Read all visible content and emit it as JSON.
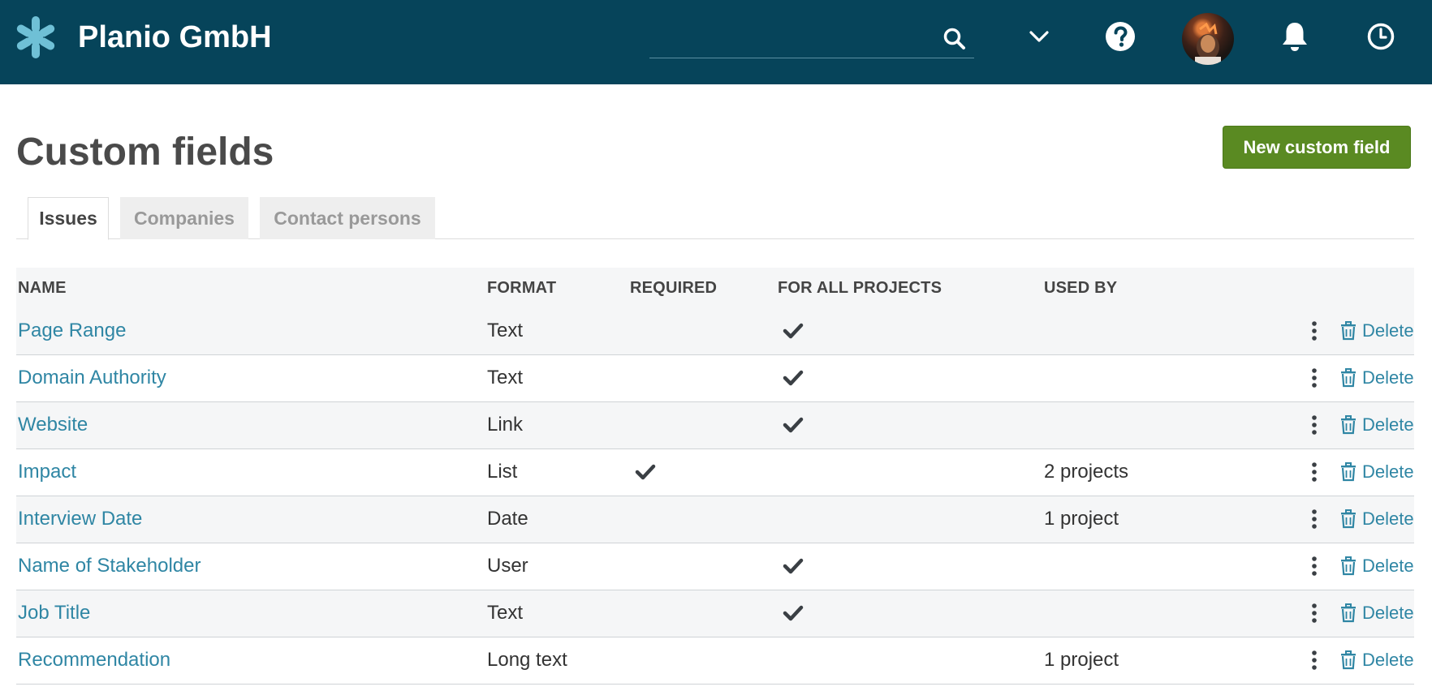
{
  "header": {
    "brand": "Planio GmbH",
    "search_placeholder": "",
    "colors": {
      "topbar": "#06445a",
      "accent": "#2f86a4",
      "primary_button": "#5a8a22"
    }
  },
  "page": {
    "title": "Custom fields",
    "new_button": "New custom field"
  },
  "tabs": [
    {
      "label": "Issues",
      "active": true
    },
    {
      "label": "Companies",
      "active": false
    },
    {
      "label": "Contact persons",
      "active": false
    }
  ],
  "table": {
    "columns": {
      "name": "NAME",
      "format": "FORMAT",
      "required": "REQUIRED",
      "for_all": "FOR ALL PROJECTS",
      "used_by": "USED BY"
    },
    "rows": [
      {
        "name": "Page Range",
        "format": "Text",
        "required": false,
        "for_all": true,
        "used_by": "",
        "delete": "Delete"
      },
      {
        "name": "Domain Authority",
        "format": "Text",
        "required": false,
        "for_all": true,
        "used_by": "",
        "delete": "Delete"
      },
      {
        "name": "Website",
        "format": "Link",
        "required": false,
        "for_all": true,
        "used_by": "",
        "delete": "Delete"
      },
      {
        "name": "Impact",
        "format": "List",
        "required": true,
        "for_all": false,
        "used_by": "2 projects",
        "delete": "Delete"
      },
      {
        "name": "Interview Date",
        "format": "Date",
        "required": false,
        "for_all": false,
        "used_by": "1 project",
        "delete": "Delete"
      },
      {
        "name": "Name of Stakeholder",
        "format": "User",
        "required": false,
        "for_all": true,
        "used_by": "",
        "delete": "Delete"
      },
      {
        "name": "Job Title",
        "format": "Text",
        "required": false,
        "for_all": true,
        "used_by": "",
        "delete": "Delete"
      },
      {
        "name": "Recommendation",
        "format": "Long text",
        "required": false,
        "for_all": false,
        "used_by": "1 project",
        "delete": "Delete"
      }
    ]
  }
}
